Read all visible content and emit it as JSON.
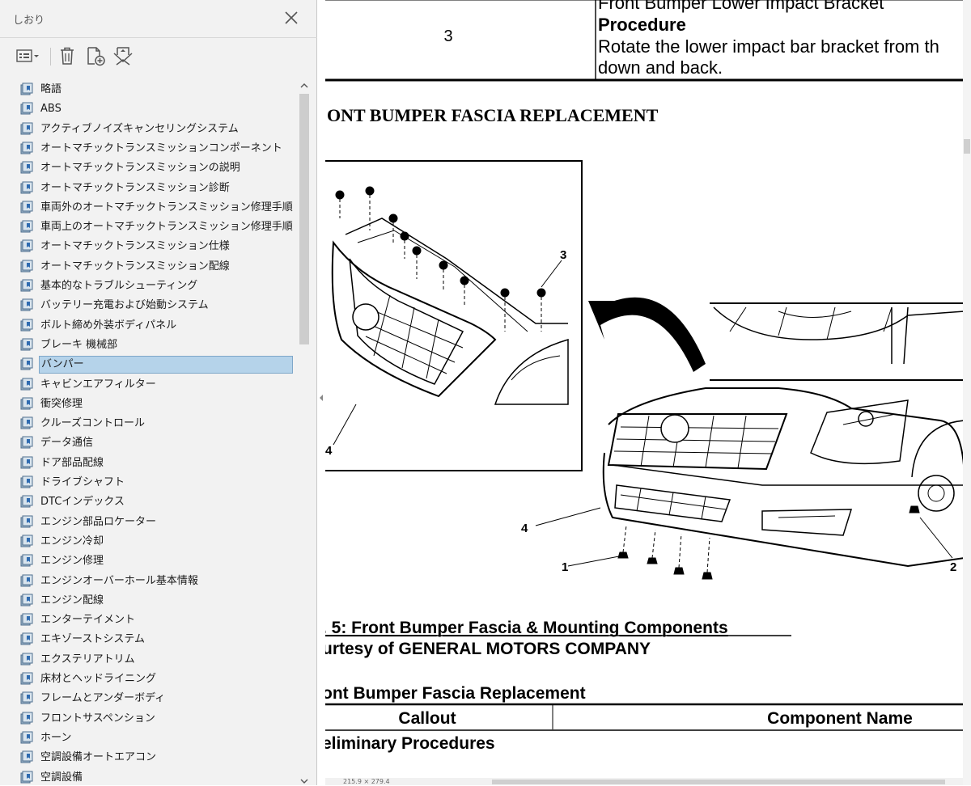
{
  "pane": {
    "title": "しおり",
    "close_icon": "close-icon",
    "toolbar_icons": [
      "options-menu-icon",
      "delete-bookmark-icon",
      "new-bookmark-icon",
      "find-bookmark-icon"
    ]
  },
  "bookmarks": [
    {
      "label": "略語"
    },
    {
      "label": "ABS"
    },
    {
      "label": "アクティブノイズキャンセリングシステム"
    },
    {
      "label": "オートマチックトランスミッションコンポーネント"
    },
    {
      "label": "オートマチックトランスミッションの説明"
    },
    {
      "label": "オートマチックトランスミッション診断"
    },
    {
      "label": "車両外のオートマチックトランスミッション修理手順"
    },
    {
      "label": "車両上のオートマチックトランスミッション修理手順"
    },
    {
      "label": "オートマチックトランスミッション仕様"
    },
    {
      "label": "オートマチックトランスミッション配線"
    },
    {
      "label": "基本的なトラブルシューティング"
    },
    {
      "label": "バッテリー充電および始動システム"
    },
    {
      "label": "ボルト締め外装ボディパネル"
    },
    {
      "label": "ブレーキ 機械部"
    },
    {
      "label": "バンパー",
      "selected": true
    },
    {
      "label": "キャビンエアフィルター"
    },
    {
      "label": "衝突修理"
    },
    {
      "label": "クルーズコントロール"
    },
    {
      "label": "データ通信"
    },
    {
      "label": "ドア部品配線"
    },
    {
      "label": "ドライブシャフト"
    },
    {
      "label": "DTCインデックス"
    },
    {
      "label": "エンジン部品ロケーター"
    },
    {
      "label": "エンジン冷却"
    },
    {
      "label": "エンジン修理"
    },
    {
      "label": "エンジンオーバーホール基本情報"
    },
    {
      "label": "エンジン配線"
    },
    {
      "label": "エンターテイメント"
    },
    {
      "label": "エキゾーストシステム"
    },
    {
      "label": "エクステリアトリム"
    },
    {
      "label": "床材とヘッドライニング"
    },
    {
      "label": "フレームとアンダーボディ"
    },
    {
      "label": "フロントサスペンション"
    },
    {
      "label": "ホーン"
    },
    {
      "label": "空調設備オートエアコン"
    },
    {
      "label": "空調設備"
    }
  ],
  "doc": {
    "top_table": {
      "step": "3",
      "title_partial": "Front Bumper Lower Impact Bracket",
      "procedure_label": "Procedure",
      "text_line1": "Rotate the lower impact bar bracket from th",
      "text_line2": "down and back."
    },
    "section_heading": "ONT BUMPER FASCIA REPLACEMENT",
    "callouts": {
      "c1": "1",
      "c2": "2",
      "c3": "3",
      "c4a": "4",
      "c4b": "4"
    },
    "figure_caption": ". 5: Front Bumper Fascia & Mounting Components",
    "courtesy": "urtesy of GENERAL MOTORS COMPANY",
    "sub_heading": "ont Bumper Fascia Replacement",
    "table_head": {
      "callout": "Callout",
      "component": "Component Name"
    },
    "table_row1": "eliminary Procedures",
    "page_size": "215.9 × 279.4"
  }
}
